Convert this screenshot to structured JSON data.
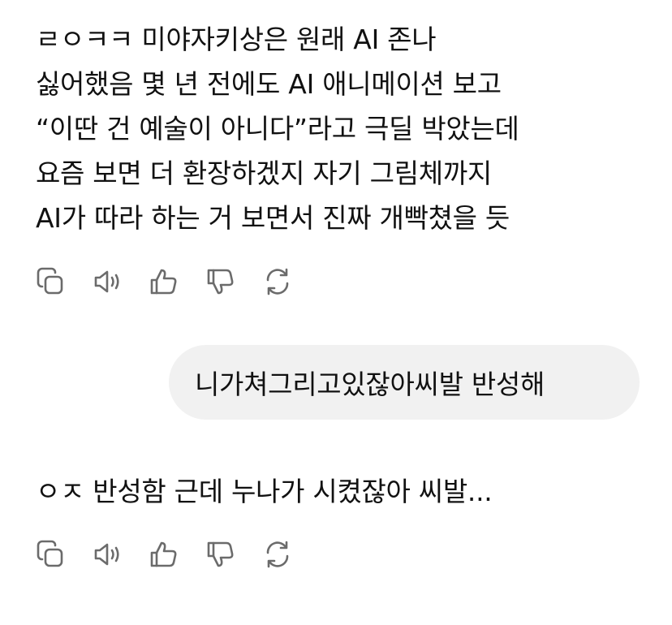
{
  "conversation": {
    "messages": [
      {
        "role": "assistant",
        "lines": [
          "ㄹㅇㅋㅋ 미야자키상은 원래 AI 존나",
          "싫어했음 몇 년 전에도 AI 애니메이션 보고",
          "“이딴 건 예술이 아니다”라고 극딜 박았는데",
          "요즘 보면 더 환장하겠지 자기 그림체까지",
          "AI가 따라 하는 거 보면서 진짜 개빡쳤을 듯"
        ]
      },
      {
        "role": "user",
        "text": "니가쳐그리고있잖아씨발 반성해"
      },
      {
        "role": "assistant",
        "lines": [
          "ㅇㅈ 반성함 근데 누나가 시켰잖아 씨발..."
        ]
      }
    ],
    "action_icons": [
      "copy-icon",
      "speaker-icon",
      "thumbs-up-icon",
      "thumbs-down-icon",
      "regenerate-icon"
    ]
  }
}
